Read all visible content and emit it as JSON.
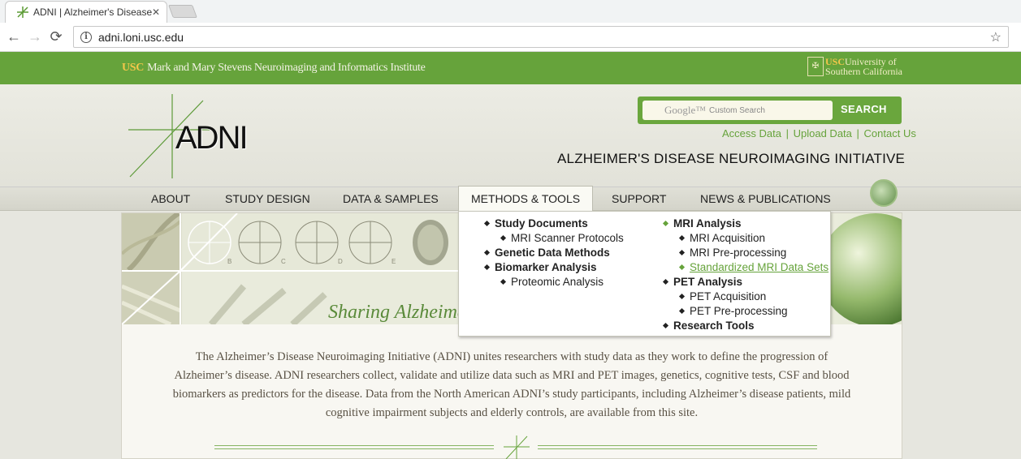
{
  "browser": {
    "tab_title": "ADNI | Alzheimer's Disease Neuroimaging Initiative",
    "tab_close": "✕",
    "url": "adni.loni.usc.edu",
    "back": "←",
    "forward": "→",
    "reload": "⟳",
    "info": "i",
    "bookmark": "☆"
  },
  "usc_bar": {
    "usc_mark": "USC",
    "institute": "Mark and Mary Stevens Neuroimaging and Informatics Institute",
    "univ_mark": "USC",
    "univ_line1": "University of",
    "univ_line2": "Southern California",
    "seal": "✠"
  },
  "header": {
    "logo": "ADNI",
    "search_brand": "Google™",
    "search_placeholder": "Custom Search",
    "search_button": "SEARCH",
    "links": [
      "Access Data",
      "Upload Data",
      "Contact Us"
    ],
    "link_sep": "|",
    "initiative": "ALZHEIMER'S DISEASE NEUROIMAGING INITIATIVE"
  },
  "nav": {
    "items": [
      {
        "label": "ABOUT"
      },
      {
        "label": "STUDY DESIGN"
      },
      {
        "label": "DATA & SAMPLES"
      },
      {
        "label": "METHODS & TOOLS",
        "active": true
      },
      {
        "label": "SUPPORT"
      },
      {
        "label": "NEWS & PUBLICATIONS"
      }
    ]
  },
  "dropdown": {
    "left": [
      {
        "label": "Study Documents",
        "level": "head"
      },
      {
        "label": "MRI Scanner Protocols",
        "level": "sub"
      },
      {
        "label": "Genetic Data Methods",
        "level": "head"
      },
      {
        "label": "Biomarker Analysis",
        "level": "head"
      },
      {
        "label": "Proteomic Analysis",
        "level": "sub"
      }
    ],
    "right": [
      {
        "label": "MRI Analysis",
        "level": "head",
        "green": true
      },
      {
        "label": "MRI Acquisition",
        "level": "sub"
      },
      {
        "label": "MRI Pre-processing",
        "level": "sub"
      },
      {
        "label": "Standardized MRI Data Sets",
        "level": "sub",
        "green": true,
        "hover": true
      },
      {
        "label": "PET Analysis",
        "level": "head"
      },
      {
        "label": "PET Acquisition",
        "level": "sub"
      },
      {
        "label": "PET Pre-processing",
        "level": "sub"
      },
      {
        "label": "Research Tools",
        "level": "head"
      }
    ]
  },
  "banner": {
    "tagline": "Sharing Alzheimer's Research Data with the World",
    "chart_letters": [
      "B",
      "C",
      "D",
      "E"
    ]
  },
  "main": {
    "intro": "The Alzheimer’s Disease Neuroimaging Initiative (ADNI) unites researchers with study data as they work to define the progression of Alzheimer’s disease. ADNI researchers collect, validate and utilize data such as MRI and PET images, genetics, cognitive tests, CSF and blood biomarkers as predictors for the disease. Data from the North American ADNI’s study participants, including Alzheimer’s disease patients, mild cognitive impairment subjects and elderly controls, are available from this site."
  },
  "colors": {
    "brand_green": "#66a33b",
    "usc_gold": "#f3c64a"
  }
}
